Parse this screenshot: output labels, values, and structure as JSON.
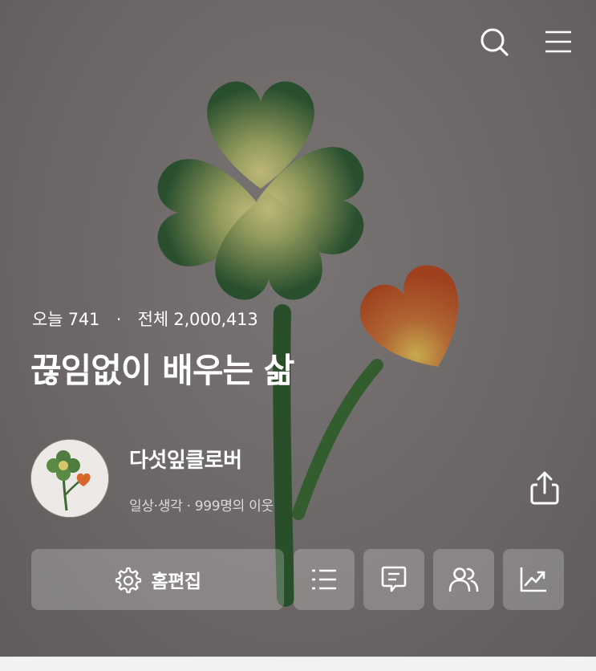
{
  "header": {
    "search_icon": "search-icon",
    "menu_icon": "menu-icon"
  },
  "blog": {
    "stats": {
      "today_label": "오늘",
      "today_value": "741",
      "separator": "·",
      "total_label": "전체",
      "total_value": "2,000,413"
    },
    "title": "끊임없이 배우는 삶",
    "nickname": "다섯잎클로버",
    "meta": "일상·생각 · 999명의 이웃"
  },
  "actions": {
    "edit_label": "홈편집",
    "edit_icon": "gear-icon",
    "share_icon": "share-icon",
    "list_icon": "list-icon",
    "comment_icon": "comment-icon",
    "neighbors_icon": "people-icon",
    "stats_icon": "chart-icon"
  },
  "colors": {
    "accent_text": "#ffffff",
    "hero_background": "#7c7676",
    "button_background": "rgba(255,255,255,0.22)"
  }
}
